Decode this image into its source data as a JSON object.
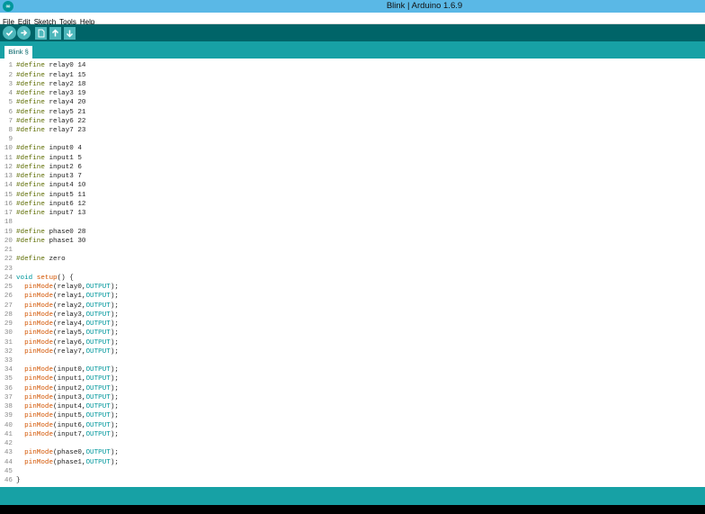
{
  "window": {
    "title": "Blink | Arduino 1.6.9",
    "icon": "arduino-logo-icon"
  },
  "menu": [
    "File",
    "Edit",
    "Sketch",
    "Tools",
    "Help"
  ],
  "toolbar": {
    "buttons": [
      {
        "name": "verify-button",
        "icon": "checkmark-icon"
      },
      {
        "name": "upload-button",
        "icon": "arrow-right-icon"
      },
      {
        "name": "new-button",
        "icon": "new-file-icon"
      },
      {
        "name": "open-button",
        "icon": "arrow-up-icon"
      },
      {
        "name": "save-button",
        "icon": "arrow-down-icon"
      }
    ]
  },
  "tabs": [
    {
      "label": "Blink §"
    }
  ],
  "colors": {
    "teal": "#00979c",
    "dark_teal": "#006468",
    "mid_teal": "#17a1a5",
    "titlebar": "#5ab8e6",
    "define": "#5e6d03",
    "function": "#d35400"
  },
  "code_lines": [
    {
      "n": "1",
      "tokens": [
        [
          "define",
          "#define"
        ],
        [
          "plain",
          " relay0 14"
        ]
      ]
    },
    {
      "n": "2",
      "tokens": [
        [
          "define",
          "#define"
        ],
        [
          "plain",
          " relay1 15"
        ]
      ]
    },
    {
      "n": "3",
      "tokens": [
        [
          "define",
          "#define"
        ],
        [
          "plain",
          " relay2 18"
        ]
      ]
    },
    {
      "n": "4",
      "tokens": [
        [
          "define",
          "#define"
        ],
        [
          "plain",
          " relay3 19"
        ]
      ]
    },
    {
      "n": "5",
      "tokens": [
        [
          "define",
          "#define"
        ],
        [
          "plain",
          " relay4 20"
        ]
      ]
    },
    {
      "n": "6",
      "tokens": [
        [
          "define",
          "#define"
        ],
        [
          "plain",
          " relay5 21"
        ]
      ]
    },
    {
      "n": "7",
      "tokens": [
        [
          "define",
          "#define"
        ],
        [
          "plain",
          " relay6 22"
        ]
      ]
    },
    {
      "n": "8",
      "tokens": [
        [
          "define",
          "#define"
        ],
        [
          "plain",
          " relay7 23"
        ]
      ]
    },
    {
      "n": "9",
      "tokens": []
    },
    {
      "n": "10",
      "tokens": [
        [
          "define",
          "#define"
        ],
        [
          "plain",
          " input0 4"
        ]
      ]
    },
    {
      "n": "11",
      "tokens": [
        [
          "define",
          "#define"
        ],
        [
          "plain",
          " input1 5"
        ]
      ]
    },
    {
      "n": "12",
      "tokens": [
        [
          "define",
          "#define"
        ],
        [
          "plain",
          " input2 6"
        ]
      ]
    },
    {
      "n": "13",
      "tokens": [
        [
          "define",
          "#define"
        ],
        [
          "plain",
          " input3 7"
        ]
      ]
    },
    {
      "n": "14",
      "tokens": [
        [
          "define",
          "#define"
        ],
        [
          "plain",
          " input4 10"
        ]
      ]
    },
    {
      "n": "15",
      "tokens": [
        [
          "define",
          "#define"
        ],
        [
          "plain",
          " input5 11"
        ]
      ]
    },
    {
      "n": "16",
      "tokens": [
        [
          "define",
          "#define"
        ],
        [
          "plain",
          " input6 12"
        ]
      ]
    },
    {
      "n": "17",
      "tokens": [
        [
          "define",
          "#define"
        ],
        [
          "plain",
          " input7 13"
        ]
      ]
    },
    {
      "n": "18",
      "tokens": []
    },
    {
      "n": "19",
      "tokens": [
        [
          "define",
          "#define"
        ],
        [
          "plain",
          " phase0 28"
        ]
      ]
    },
    {
      "n": "20",
      "tokens": [
        [
          "define",
          "#define"
        ],
        [
          "plain",
          " phase1 30"
        ]
      ]
    },
    {
      "n": "21",
      "tokens": []
    },
    {
      "n": "22",
      "tokens": [
        [
          "define",
          "#define"
        ],
        [
          "plain",
          " zero"
        ]
      ]
    },
    {
      "n": "23",
      "tokens": []
    },
    {
      "n": "24",
      "tokens": [
        [
          "void",
          "void"
        ],
        [
          "plain",
          " "
        ],
        [
          "fn",
          "setup"
        ],
        [
          "plain",
          "() {"
        ]
      ]
    },
    {
      "n": "25",
      "tokens": [
        [
          "plain",
          "  "
        ],
        [
          "fn",
          "pinMode"
        ],
        [
          "plain",
          "(relay0,"
        ],
        [
          "const",
          "OUTPUT"
        ],
        [
          "plain",
          ");"
        ]
      ]
    },
    {
      "n": "26",
      "tokens": [
        [
          "plain",
          "  "
        ],
        [
          "fn",
          "pinMode"
        ],
        [
          "plain",
          "(relay1,"
        ],
        [
          "const",
          "OUTPUT"
        ],
        [
          "plain",
          ");"
        ]
      ]
    },
    {
      "n": "27",
      "tokens": [
        [
          "plain",
          "  "
        ],
        [
          "fn",
          "pinMode"
        ],
        [
          "plain",
          "(relay2,"
        ],
        [
          "const",
          "OUTPUT"
        ],
        [
          "plain",
          ");"
        ]
      ]
    },
    {
      "n": "28",
      "tokens": [
        [
          "plain",
          "  "
        ],
        [
          "fn",
          "pinMode"
        ],
        [
          "plain",
          "(relay3,"
        ],
        [
          "const",
          "OUTPUT"
        ],
        [
          "plain",
          ");"
        ]
      ]
    },
    {
      "n": "29",
      "tokens": [
        [
          "plain",
          "  "
        ],
        [
          "fn",
          "pinMode"
        ],
        [
          "plain",
          "(relay4,"
        ],
        [
          "const",
          "OUTPUT"
        ],
        [
          "plain",
          ");"
        ]
      ]
    },
    {
      "n": "30",
      "tokens": [
        [
          "plain",
          "  "
        ],
        [
          "fn",
          "pinMode"
        ],
        [
          "plain",
          "(relay5,"
        ],
        [
          "const",
          "OUTPUT"
        ],
        [
          "plain",
          ");"
        ]
      ]
    },
    {
      "n": "31",
      "tokens": [
        [
          "plain",
          "  "
        ],
        [
          "fn",
          "pinMode"
        ],
        [
          "plain",
          "(relay6,"
        ],
        [
          "const",
          "OUTPUT"
        ],
        [
          "plain",
          ");"
        ]
      ]
    },
    {
      "n": "32",
      "tokens": [
        [
          "plain",
          "  "
        ],
        [
          "fn",
          "pinMode"
        ],
        [
          "plain",
          "(relay7,"
        ],
        [
          "const",
          "OUTPUT"
        ],
        [
          "plain",
          ");"
        ]
      ]
    },
    {
      "n": "33",
      "tokens": []
    },
    {
      "n": "34",
      "tokens": [
        [
          "plain",
          "  "
        ],
        [
          "fn",
          "pinMode"
        ],
        [
          "plain",
          "(input0,"
        ],
        [
          "const",
          "OUTPUT"
        ],
        [
          "plain",
          ");"
        ]
      ]
    },
    {
      "n": "35",
      "tokens": [
        [
          "plain",
          "  "
        ],
        [
          "fn",
          "pinMode"
        ],
        [
          "plain",
          "(input1,"
        ],
        [
          "const",
          "OUTPUT"
        ],
        [
          "plain",
          ");"
        ]
      ]
    },
    {
      "n": "36",
      "tokens": [
        [
          "plain",
          "  "
        ],
        [
          "fn",
          "pinMode"
        ],
        [
          "plain",
          "(input2,"
        ],
        [
          "const",
          "OUTPUT"
        ],
        [
          "plain",
          ");"
        ]
      ]
    },
    {
      "n": "37",
      "tokens": [
        [
          "plain",
          "  "
        ],
        [
          "fn",
          "pinMode"
        ],
        [
          "plain",
          "(input3,"
        ],
        [
          "const",
          "OUTPUT"
        ],
        [
          "plain",
          ");"
        ]
      ]
    },
    {
      "n": "38",
      "tokens": [
        [
          "plain",
          "  "
        ],
        [
          "fn",
          "pinMode"
        ],
        [
          "plain",
          "(input4,"
        ],
        [
          "const",
          "OUTPUT"
        ],
        [
          "plain",
          ");"
        ]
      ]
    },
    {
      "n": "39",
      "tokens": [
        [
          "plain",
          "  "
        ],
        [
          "fn",
          "pinMode"
        ],
        [
          "plain",
          "(input5,"
        ],
        [
          "const",
          "OUTPUT"
        ],
        [
          "plain",
          ");"
        ]
      ]
    },
    {
      "n": "40",
      "tokens": [
        [
          "plain",
          "  "
        ],
        [
          "fn",
          "pinMode"
        ],
        [
          "plain",
          "(input6,"
        ],
        [
          "const",
          "OUTPUT"
        ],
        [
          "plain",
          ");"
        ]
      ]
    },
    {
      "n": "41",
      "tokens": [
        [
          "plain",
          "  "
        ],
        [
          "fn",
          "pinMode"
        ],
        [
          "plain",
          "(input7,"
        ],
        [
          "const",
          "OUTPUT"
        ],
        [
          "plain",
          ");"
        ]
      ]
    },
    {
      "n": "42",
      "tokens": []
    },
    {
      "n": "43",
      "tokens": [
        [
          "plain",
          "  "
        ],
        [
          "fn",
          "pinMode"
        ],
        [
          "plain",
          "(phase0,"
        ],
        [
          "const",
          "OUTPUT"
        ],
        [
          "plain",
          ");"
        ]
      ]
    },
    {
      "n": "44",
      "tokens": [
        [
          "plain",
          "  "
        ],
        [
          "fn",
          "pinMode"
        ],
        [
          "plain",
          "(phase1,"
        ],
        [
          "const",
          "OUTPUT"
        ],
        [
          "plain",
          ");"
        ]
      ]
    },
    {
      "n": "45",
      "tokens": []
    },
    {
      "n": "46",
      "tokens": [
        [
          "plain",
          "}"
        ]
      ]
    }
  ]
}
